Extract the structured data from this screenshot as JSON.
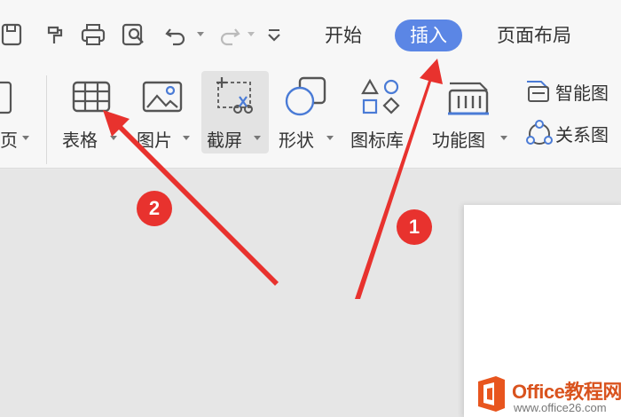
{
  "tabs": [
    {
      "label": "开始",
      "active": false
    },
    {
      "label": "插入",
      "active": true
    },
    {
      "label": "页面布局",
      "active": false
    }
  ],
  "quick_access": [
    "save-icon",
    "format-painter-icon",
    "print-icon",
    "print-preview-icon",
    "undo-icon",
    "redo-icon",
    "customize-icon"
  ],
  "ribbon": {
    "page_label": "页",
    "table_label": "表格",
    "picture_label": "图片",
    "screenshot_label": "截屏",
    "shape_label": "形状",
    "iconlib_label": "图标库",
    "function_chart_label": "功能图",
    "smart_graphic_label": "智能图",
    "relation_graph_label": "关系图"
  },
  "annotations": {
    "badge_1": "1",
    "badge_2": "2"
  },
  "watermark": {
    "title": "Office教程网",
    "url": "www.office26.com"
  },
  "colors": {
    "active_tab": "#5b86e5",
    "annotation_red": "#e8322e",
    "watermark_orange": "#d9531e"
  }
}
